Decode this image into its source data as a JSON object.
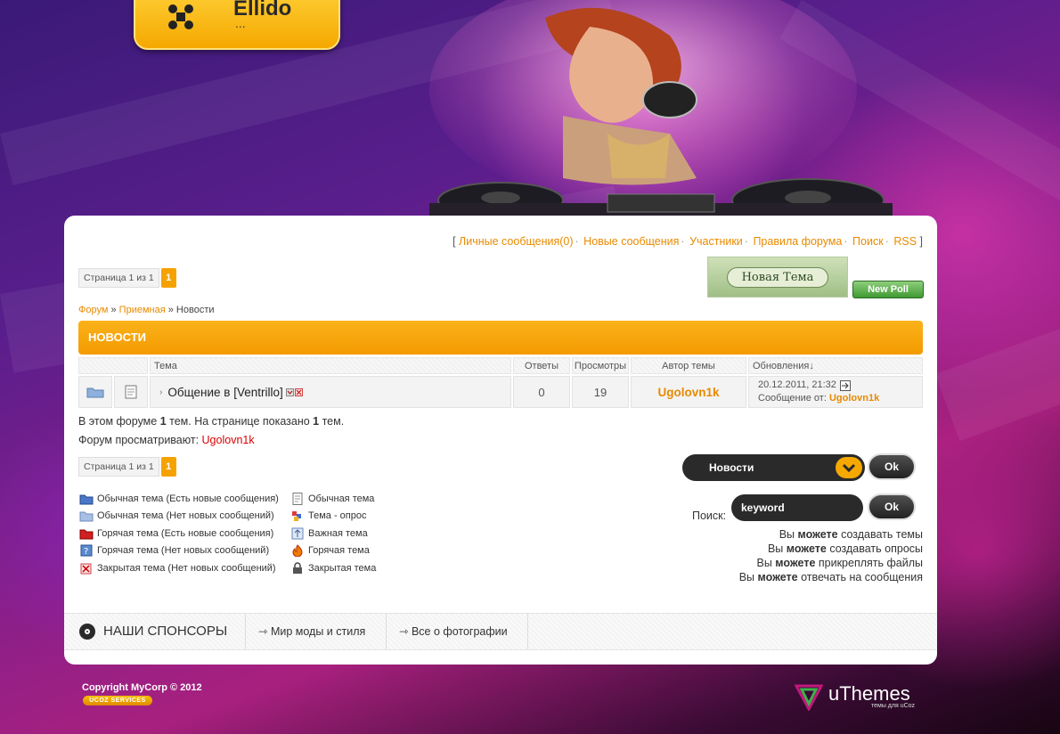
{
  "site": {
    "logo_title": "Ellido",
    "logo_subtitle": "..."
  },
  "toplinks": {
    "open": "[",
    "close": "]",
    "items": [
      "Личные сообщения(0)",
      "Новые сообщения",
      "Участники",
      "Правила форума",
      "Поиск",
      "RSS"
    ]
  },
  "pager": {
    "info": "Страница 1 из 1",
    "current": "1"
  },
  "buttons": {
    "new_topic": "Новая Тема",
    "new_poll": "New Poll",
    "ok": "Ok"
  },
  "breadcrumb": {
    "items": [
      "Форум",
      "Приемная",
      "Новости"
    ],
    "sep": "»"
  },
  "forum": {
    "title": "НОВОСТИ",
    "columns": {
      "topic": "Тема",
      "replies": "Ответы",
      "views": "Просмотры",
      "author": "Автор темы",
      "updated": "Обновления↓"
    },
    "rows": [
      {
        "title": "Общение в [Ventrillo]",
        "replies": "0",
        "views": "19",
        "author": "Ugolovn1k",
        "updated_date": "20.12.2011, 21:32",
        "last_post_label": "Сообщение от:",
        "last_post_user": "Ugolovn1k"
      }
    ]
  },
  "stats": {
    "part1": "В этом форуме ",
    "topics": "1",
    "part2": " тем. На странице показано ",
    "shown": "1",
    "part3": " тем.",
    "viewers_label": "Форум просматривают:",
    "viewer": "Ugolovn1k"
  },
  "jump": {
    "selected": "Новости"
  },
  "search": {
    "label": "Поиск:",
    "value": "keyword"
  },
  "permissions": [
    {
      "pre": "Вы ",
      "bold": "можете",
      "post": " создавать темы"
    },
    {
      "pre": "Вы ",
      "bold": "можете",
      "post": " создавать опросы"
    },
    {
      "pre": "Вы ",
      "bold": "можете",
      "post": " прикреплять файлы"
    },
    {
      "pre": "Вы ",
      "bold": "можете",
      "post": " отвечать на сообщения"
    }
  ],
  "legend_left": [
    "Обычная тема (Есть новые сообщения)",
    "Обычная тема (Нет новых сообщений)",
    "Горячая тема (Есть новые сообщения)",
    "Горячая тема (Нет новых сообщений)",
    "Закрытая тема (Нет новых сообщений)"
  ],
  "legend_right": [
    "Обычная тема",
    "Тема - опрос",
    "Важная тема",
    "Горячая тема",
    "Закрытая тема"
  ],
  "sponsors": {
    "title": "НАШИ СПОНСОРЫ",
    "links": [
      "Мир моды и стиля",
      "Все о фотографии"
    ]
  },
  "footer": {
    "copyright": "Copyright MyCorp © 2012",
    "ucoz_badge": "UCOZ SERVICES",
    "brand": "uThemes",
    "brand_tag": "темы для uCoz"
  },
  "colors": {
    "accent": "#f5a200",
    "link": "#e88a00",
    "dark": "#2a2a2a"
  }
}
